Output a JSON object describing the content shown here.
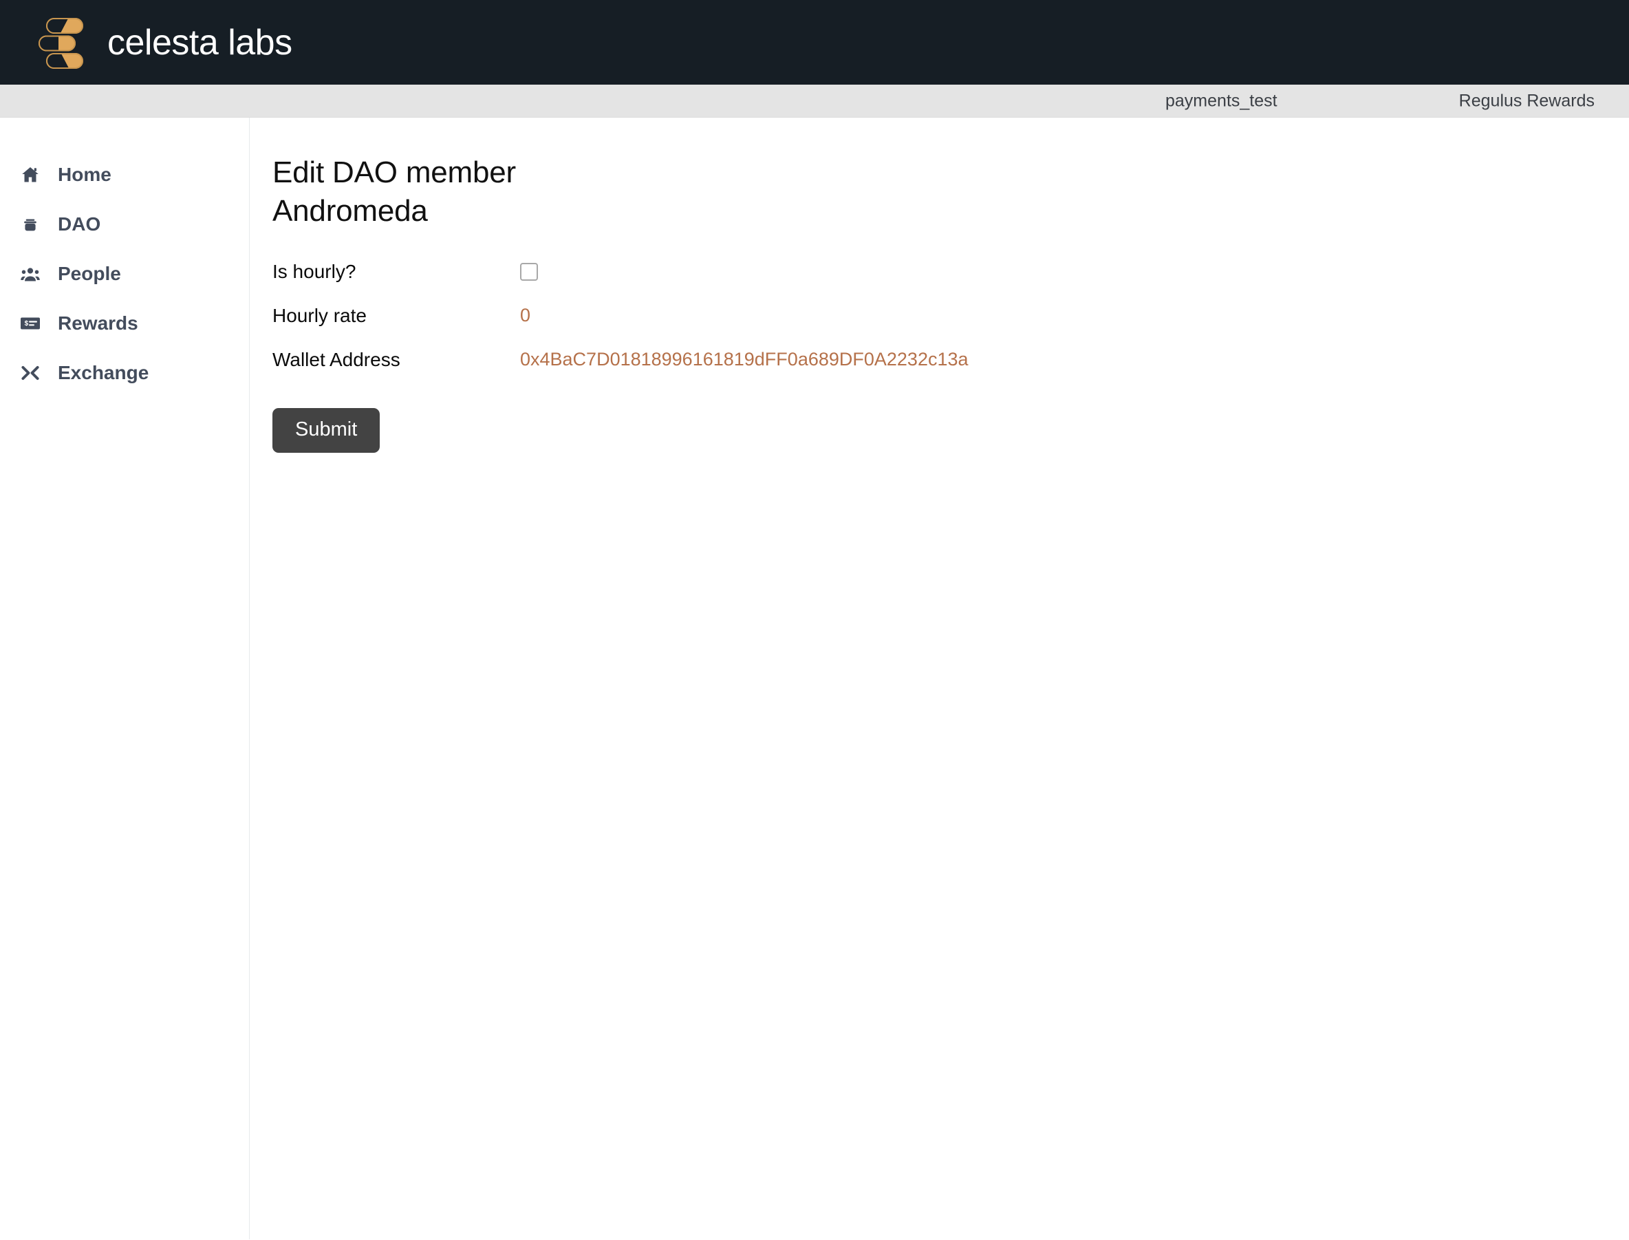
{
  "header": {
    "brand_name": "celesta labs",
    "logo_icon": "celesta-bars-logo",
    "bg_color": "#161e25",
    "logo_color": "#e0a85c"
  },
  "subbar": {
    "project_label": "payments_test",
    "account_label": "Regulus Rewards",
    "bg_color": "#e4e4e4"
  },
  "sidebar": {
    "items": [
      {
        "label": "Home",
        "icon": "home-icon"
      },
      {
        "label": "DAO",
        "icon": "bank-icon"
      },
      {
        "label": "People",
        "icon": "people-icon"
      },
      {
        "label": "Rewards",
        "icon": "payment-card-icon"
      },
      {
        "label": "Exchange",
        "icon": "exchange-icon"
      }
    ]
  },
  "main": {
    "page_title": "Edit DAO member Andromeda",
    "fields": [
      {
        "label": "Is hourly?",
        "type": "checkbox",
        "checked": false,
        "value": ""
      },
      {
        "label": "Hourly rate",
        "type": "text",
        "value": "0"
      },
      {
        "label": "Wallet Address",
        "type": "text",
        "value": "0x4BaC7D01818996161819dFF0a689DF0A2232c13a"
      }
    ],
    "submit_label": "Submit",
    "value_color": "#b5714a",
    "submit_bg": "#434343"
  }
}
